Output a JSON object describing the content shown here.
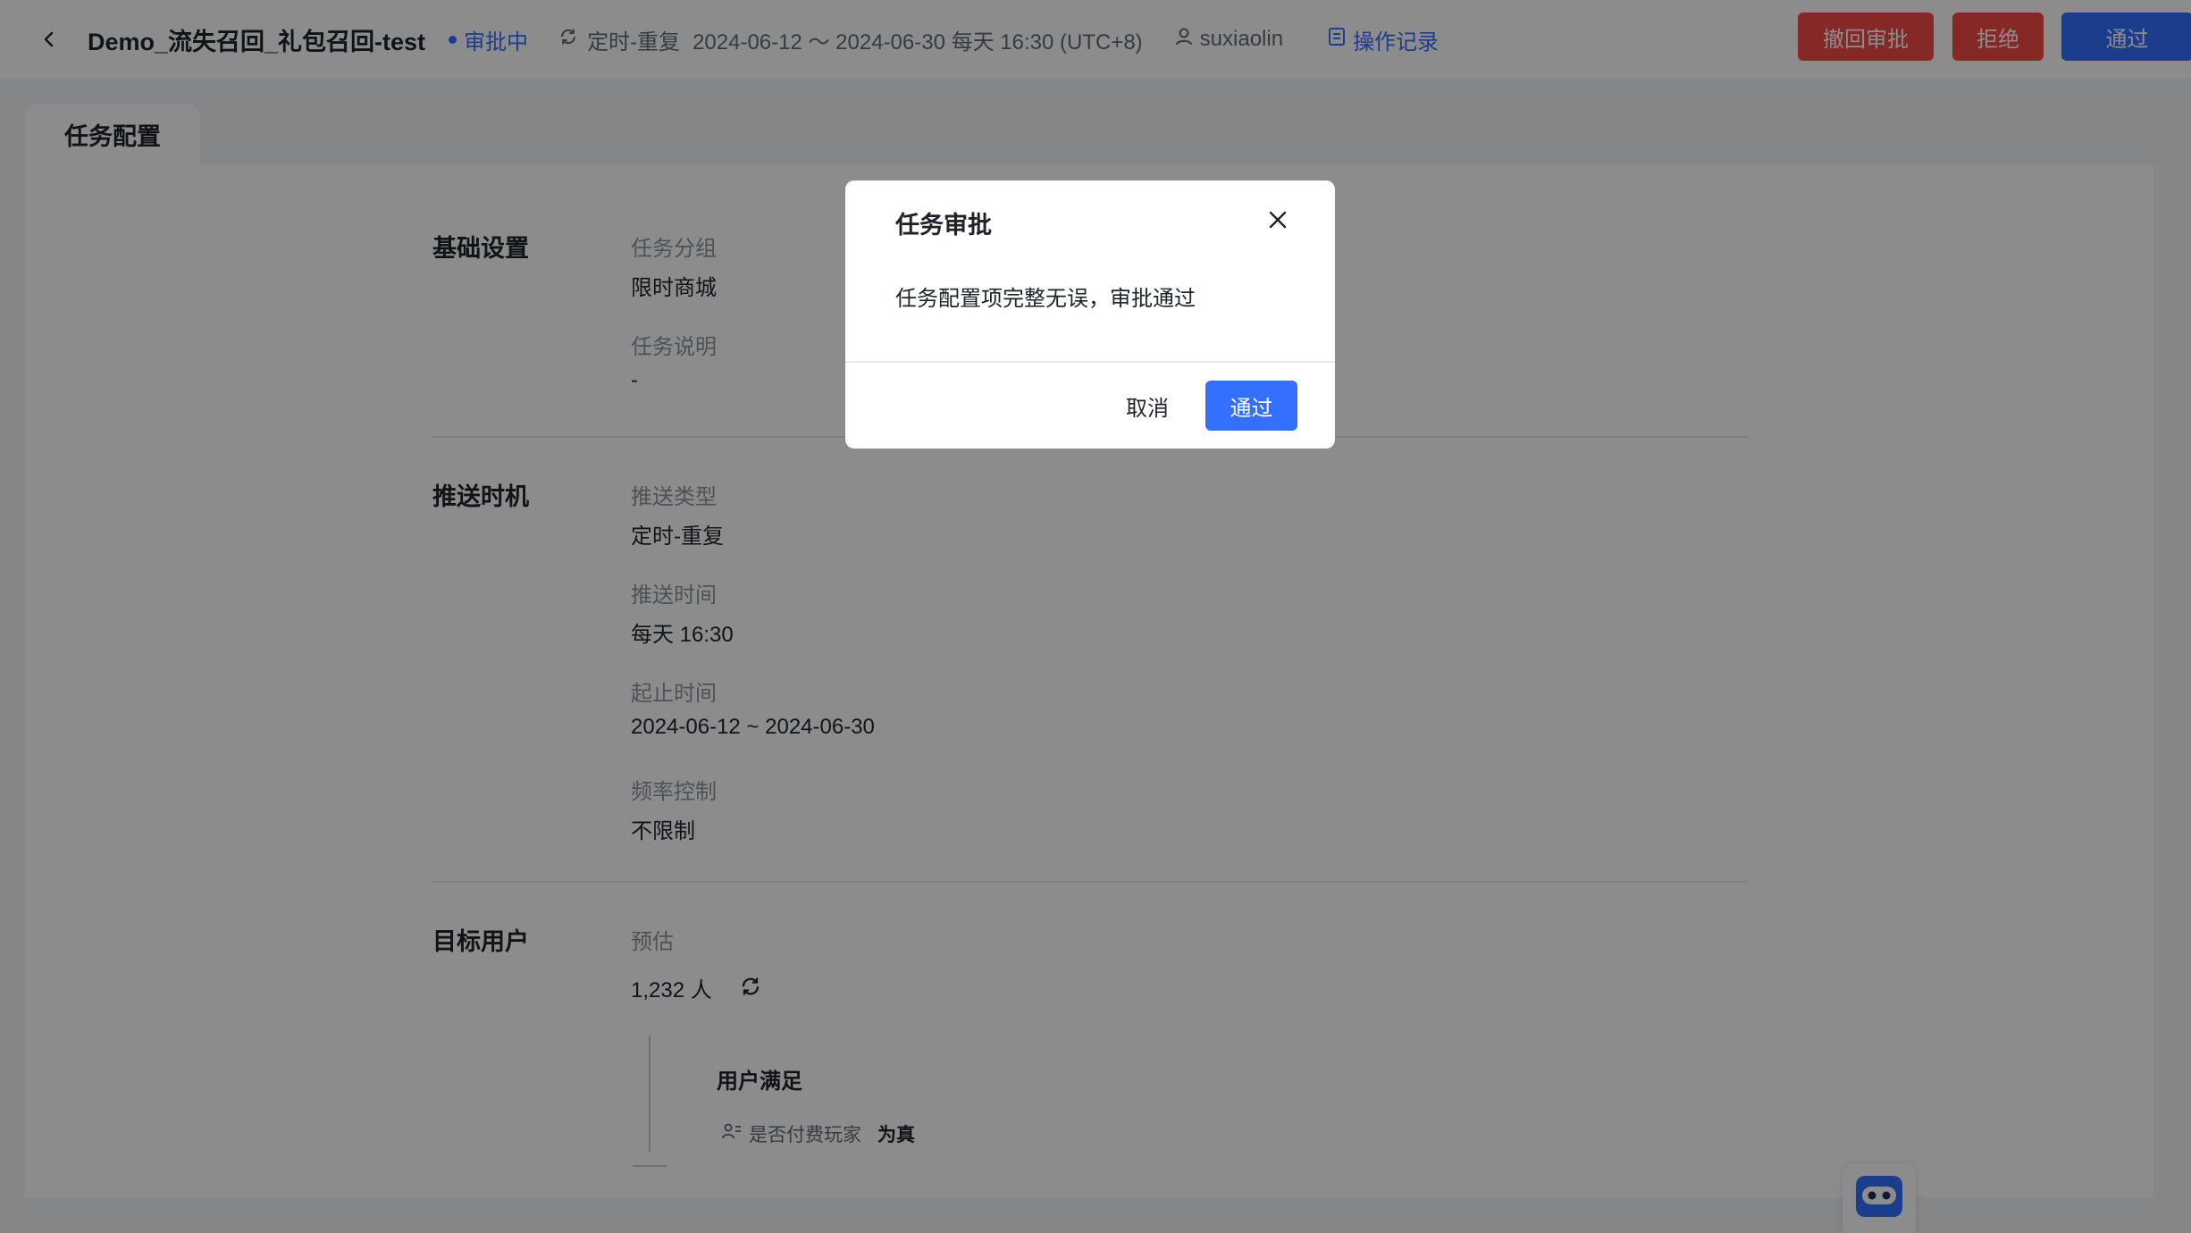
{
  "header": {
    "task_name": "Demo_流失召回_礼包召回-test",
    "status": "审批中",
    "schedule_type": "定时-重复",
    "schedule_detail": "2024-06-12 ～ 2024-06-30 每天 16:30 (UTC+8)",
    "owner": "suxiaolin",
    "operation_log": "操作记录",
    "actions": {
      "withdraw": "撤回审批",
      "reject": "拒绝",
      "approve": "通过"
    }
  },
  "tab": {
    "label": "任务配置"
  },
  "sections": {
    "basic": {
      "title": "基础设置",
      "group_label": "任务分组",
      "group_value": "限时商城",
      "desc_label": "任务说明",
      "desc_value": "-"
    },
    "push": {
      "title": "推送时机",
      "type_label": "推送类型",
      "type_value": "定时-重复",
      "time_label": "推送时间",
      "time_value": "每天 16:30",
      "range_label": "起止时间",
      "range_value": "2024-06-12 ~ 2024-06-30",
      "freq_label": "频率控制",
      "freq_value": "不限制"
    },
    "target": {
      "title": "目标用户",
      "estimate_label": "预估",
      "estimate_value": "1,232 人",
      "condition_group_title": "用户满足",
      "condition": {
        "field": "是否付费玩家",
        "operator": "为真"
      }
    }
  },
  "modal": {
    "title": "任务审批",
    "message": "任务配置项完整无误，审批通过",
    "cancel_label": "取消",
    "confirm_label": "通过"
  },
  "colors": {
    "primary": "#3370ff",
    "danger": "#f54a45",
    "mask": "rgba(0,0,0,0.45)"
  }
}
